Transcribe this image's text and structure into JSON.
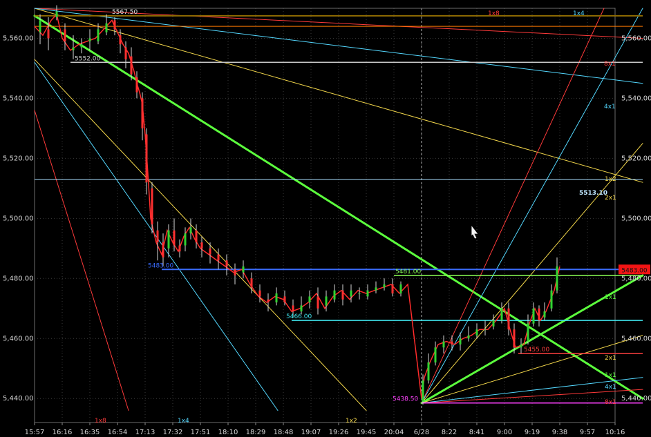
{
  "chart_data": {
    "type": "line",
    "title": "",
    "xlabel": "",
    "ylabel": "",
    "ylim": [
      5432,
      5570
    ],
    "grid": true,
    "x_ticks": [
      "15:57",
      "16:16",
      "16:35",
      "16:54",
      "17:13",
      "17:32",
      "17:51",
      "18:10",
      "18:29",
      "18:48",
      "19:07",
      "19:26",
      "19:45",
      "20:04",
      "6/28",
      "8:22",
      "8:41",
      "9:00",
      "9:19",
      "9:38",
      "9:57",
      "10:16"
    ],
    "y_ticks": [
      5440,
      5460,
      5480,
      5500,
      5520,
      5540,
      5560
    ],
    "y_tick_labels": [
      "5,440.00",
      "5,460.00",
      "5,480.00",
      "5,500.00",
      "5,520.00",
      "5,540.00",
      "5,560.00"
    ],
    "price_points": [
      [
        0,
        5564
      ],
      [
        0.3,
        5561
      ],
      [
        0.6,
        5566
      ],
      [
        0.8,
        5568
      ],
      [
        1.0,
        5560
      ],
      [
        1.3,
        5556
      ],
      [
        1.6,
        5558
      ],
      [
        1.9,
        5559
      ],
      [
        2.2,
        5560
      ],
      [
        2.5,
        5563
      ],
      [
        2.8,
        5566
      ],
      [
        3.0,
        5562
      ],
      [
        3.2,
        5558
      ],
      [
        3.4,
        5555
      ],
      [
        3.6,
        5549
      ],
      [
        3.7,
        5545
      ],
      [
        3.8,
        5542
      ],
      [
        3.9,
        5538
      ],
      [
        4.0,
        5528
      ],
      [
        4.1,
        5515
      ],
      [
        4.2,
        5500
      ],
      [
        4.4,
        5492
      ],
      [
        4.6,
        5488
      ],
      [
        4.8,
        5496
      ],
      [
        5.0,
        5492
      ],
      [
        5.2,
        5489
      ],
      [
        5.4,
        5494
      ],
      [
        5.6,
        5497
      ],
      [
        5.8,
        5493
      ],
      [
        6.0,
        5490
      ],
      [
        6.3,
        5488
      ],
      [
        6.6,
        5486
      ],
      [
        6.9,
        5484
      ],
      [
        7.2,
        5482
      ],
      [
        7.5,
        5483
      ],
      [
        7.8,
        5478
      ],
      [
        8.1,
        5474
      ],
      [
        8.4,
        5472
      ],
      [
        8.7,
        5474
      ],
      [
        9.0,
        5473
      ],
      [
        9.3,
        5469
      ],
      [
        9.6,
        5470
      ],
      [
        9.9,
        5472
      ],
      [
        10.2,
        5475
      ],
      [
        10.5,
        5470
      ],
      [
        10.8,
        5474
      ],
      [
        11.1,
        5476
      ],
      [
        11.4,
        5473
      ],
      [
        11.7,
        5476
      ],
      [
        12.0,
        5475
      ],
      [
        12.3,
        5476
      ],
      [
        12.6,
        5477
      ],
      [
        12.9,
        5478
      ],
      [
        13.2,
        5475
      ],
      [
        13.5,
        5478
      ],
      [
        14.0,
        5440
      ],
      [
        14.1,
        5447
      ],
      [
        14.3,
        5452
      ],
      [
        14.6,
        5458
      ],
      [
        14.9,
        5459
      ],
      [
        15.2,
        5458
      ],
      [
        15.5,
        5460
      ],
      [
        15.8,
        5461
      ],
      [
        16.1,
        5463
      ],
      [
        16.4,
        5463
      ],
      [
        16.7,
        5466
      ],
      [
        17.0,
        5470
      ],
      [
        17.2,
        5463
      ],
      [
        17.4,
        5457
      ],
      [
        17.7,
        5458
      ],
      [
        17.9,
        5465
      ],
      [
        18.1,
        5470
      ],
      [
        18.3,
        5466
      ],
      [
        18.5,
        5469
      ],
      [
        18.8,
        5476
      ],
      [
        19.0,
        5484
      ]
    ],
    "bars": [
      [
        0.2,
        5562,
        5566,
        5558,
        5568
      ],
      [
        0.5,
        5563,
        5560,
        5556,
        5567
      ],
      [
        0.8,
        5567,
        5569,
        5566,
        5571
      ],
      [
        1.1,
        5563,
        5559,
        5556,
        5565
      ],
      [
        1.4,
        5556,
        5557,
        5553,
        5561
      ],
      [
        1.7,
        5557,
        5558,
        5555,
        5560
      ],
      [
        2.0,
        5559,
        5560,
        5556,
        5563
      ],
      [
        2.3,
        5559,
        5563,
        5558,
        5565
      ],
      [
        2.6,
        5562,
        5565,
        5561,
        5568
      ],
      [
        2.9,
        5566,
        5563,
        5561,
        5567
      ],
      [
        3.1,
        5561,
        5558,
        5555,
        5563
      ],
      [
        3.3,
        5557,
        5553,
        5550,
        5559
      ],
      [
        3.5,
        5554,
        5548,
        5546,
        5557
      ],
      [
        3.7,
        5547,
        5542,
        5540,
        5549
      ],
      [
        3.9,
        5540,
        5530,
        5526,
        5542
      ],
      [
        4.05,
        5528,
        5512,
        5508,
        5530
      ],
      [
        4.25,
        5510,
        5498,
        5495,
        5512
      ],
      [
        4.45,
        5496,
        5492,
        5486,
        5499
      ],
      [
        4.65,
        5492,
        5487,
        5484,
        5495
      ],
      [
        4.85,
        5490,
        5496,
        5487,
        5498
      ],
      [
        5.05,
        5496,
        5491,
        5489,
        5500
      ],
      [
        5.25,
        5491,
        5489,
        5487,
        5493
      ],
      [
        5.45,
        5491,
        5495,
        5489,
        5497
      ],
      [
        5.65,
        5495,
        5497,
        5493,
        5500
      ],
      [
        5.85,
        5496,
        5492,
        5490,
        5498
      ],
      [
        6.05,
        5492,
        5490,
        5487,
        5494
      ],
      [
        6.35,
        5490,
        5488,
        5485,
        5492
      ],
      [
        6.65,
        5488,
        5486,
        5483,
        5490
      ],
      [
        6.95,
        5486,
        5484,
        5481,
        5488
      ],
      [
        7.25,
        5483,
        5481,
        5478,
        5485
      ],
      [
        7.55,
        5482,
        5484,
        5480,
        5486
      ],
      [
        7.85,
        5480,
        5477,
        5475,
        5482
      ],
      [
        8.15,
        5476,
        5474,
        5472,
        5478
      ],
      [
        8.45,
        5473,
        5472,
        5469,
        5475
      ],
      [
        8.75,
        5472,
        5475,
        5471,
        5477
      ],
      [
        9.05,
        5474,
        5472,
        5471,
        5476
      ],
      [
        9.35,
        5471,
        5469,
        5467,
        5473
      ],
      [
        9.65,
        5469,
        5471,
        5468,
        5474
      ],
      [
        9.95,
        5472,
        5474,
        5470,
        5476
      ],
      [
        10.25,
        5474,
        5470,
        5468,
        5477
      ],
      [
        10.55,
        5471,
        5474,
        5469,
        5476
      ],
      [
        10.85,
        5473,
        5476,
        5472,
        5478
      ],
      [
        11.15,
        5476,
        5473,
        5471,
        5478
      ],
      [
        11.45,
        5474,
        5476,
        5472,
        5478
      ],
      [
        11.75,
        5475,
        5475,
        5473,
        5477
      ],
      [
        12.05,
        5474,
        5476,
        5473,
        5478
      ],
      [
        12.35,
        5476,
        5477,
        5475,
        5479
      ],
      [
        12.65,
        5477,
        5478,
        5476,
        5480
      ],
      [
        12.95,
        5478,
        5475,
        5474,
        5480
      ],
      [
        13.25,
        5475,
        5478,
        5474,
        5479
      ],
      [
        14.05,
        5439,
        5446,
        5438,
        5448
      ],
      [
        14.25,
        5446,
        5452,
        5445,
        5455
      ],
      [
        14.5,
        5452,
        5457,
        5451,
        5459
      ],
      [
        14.8,
        5457,
        5459,
        5455,
        5461
      ],
      [
        15.1,
        5459,
        5458,
        5456,
        5461
      ],
      [
        15.4,
        5458,
        5460,
        5456,
        5462
      ],
      [
        15.7,
        5460,
        5461,
        5459,
        5464
      ],
      [
        16.0,
        5461,
        5463,
        5460,
        5465
      ],
      [
        16.3,
        5463,
        5463,
        5461,
        5466
      ],
      [
        16.6,
        5464,
        5466,
        5463,
        5468
      ],
      [
        16.9,
        5466,
        5470,
        5465,
        5472
      ],
      [
        17.15,
        5470,
        5463,
        5461,
        5472
      ],
      [
        17.35,
        5463,
        5457,
        5455,
        5465
      ],
      [
        17.6,
        5457,
        5458,
        5455,
        5460
      ],
      [
        17.85,
        5459,
        5465,
        5458,
        5468
      ],
      [
        18.05,
        5465,
        5470,
        5464,
        5472
      ],
      [
        18.25,
        5470,
        5466,
        5464,
        5471
      ],
      [
        18.45,
        5467,
        5469,
        5466,
        5472
      ],
      [
        18.7,
        5470,
        5476,
        5469,
        5478
      ],
      [
        18.9,
        5476,
        5484,
        5475,
        5487
      ]
    ],
    "price_levels": [
      {
        "value": 5567.5,
        "label": "5567.50",
        "color": "#e8e8e8"
      },
      {
        "value": 5552.0,
        "label": "5552.00",
        "color": "#c8c8c8"
      },
      {
        "value": 5483.0,
        "label": "5483.00",
        "color": "#3a6cff"
      },
      {
        "value": 5481.0,
        "label": "5481.00",
        "color": "#8aff55"
      },
      {
        "value": 5466.0,
        "label": "5466.00",
        "color": "#40e8f0"
      },
      {
        "value": 5455.0,
        "label": "5455.00",
        "color": "#ff4040"
      },
      {
        "value": 5438.5,
        "label": "5438.50",
        "color": "#ff40ff"
      }
    ],
    "right_axis_markers": {
      "current_price": "5483.00",
      "crosshair_value": "5513.10"
    },
    "gann_fan_right_labels": [
      "1x8",
      "1x4",
      "1x2",
      "2x1",
      "1x1",
      "4x1",
      "8x1",
      "1x1",
      "2x1",
      "4x1",
      "8x1"
    ],
    "gann_fan_bottom_labels": [
      "1x8",
      "1x4",
      "1x2"
    ]
  },
  "ui": {
    "colors": {
      "background": "#000000",
      "grid": "#3a3a3a",
      "candle_up": "#31d331",
      "candle_down": "#ff3030",
      "close_line": "#ff2b2b",
      "axis_text": "#d8d8d8",
      "fan_red": "#ff3a3a",
      "fan_cyan": "#54d8ff",
      "fan_yellow": "#f4d84b",
      "fan_green": "#5cff3d",
      "gray_line": "#bfbfbf"
    },
    "cursor": "mouse-pointer-icon"
  }
}
